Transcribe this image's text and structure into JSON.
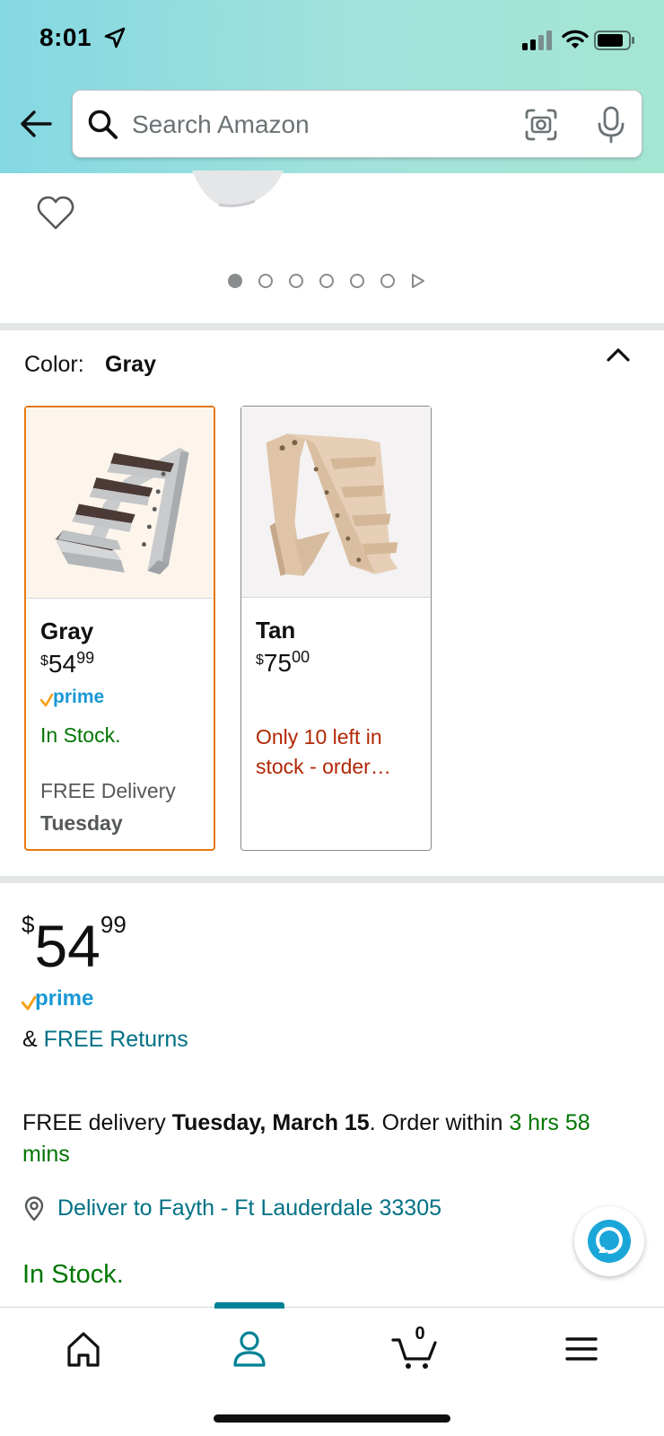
{
  "status_bar": {
    "time": "8:01"
  },
  "search": {
    "placeholder": "Search Amazon",
    "value": ""
  },
  "gallery": {
    "image_count": 6,
    "active_index": 0
  },
  "color_selector": {
    "label": "Color:",
    "selected": "Gray",
    "options": [
      {
        "name": "Gray",
        "price_symbol": "$",
        "price_whole": "54",
        "price_fraction": "99",
        "prime": true,
        "stock": "In Stock.",
        "delivery": "FREE Delivery",
        "delivery_day": "Tuesday"
      },
      {
        "name": "Tan",
        "price_symbol": "$",
        "price_whole": "75",
        "price_fraction": "00",
        "prime": false,
        "stock": "Only 10 left in stock - order…"
      }
    ]
  },
  "price": {
    "symbol": "$",
    "whole": "54",
    "fraction": "99"
  },
  "returns": {
    "prefix": "& ",
    "link": "FREE Returns"
  },
  "delivery": {
    "prefix": "FREE delivery ",
    "date": "Tuesday, March 15",
    "middle": ". Order within ",
    "countdown": "3 hrs 58 mins"
  },
  "deliver_to": "Deliver to Fayth - Ft Lauderdale 33305",
  "stock_status": "In Stock.",
  "bottom_nav": {
    "active": "account",
    "cart_count": "0"
  },
  "colors": {
    "accent_teal": "#008296",
    "link": "#007185",
    "in_stock_green": "#007600",
    "low_stock_red": "#b12704",
    "selected_border": "#e47911",
    "prime_blue": "#1a98d5",
    "prime_check": "#f6a11a"
  }
}
